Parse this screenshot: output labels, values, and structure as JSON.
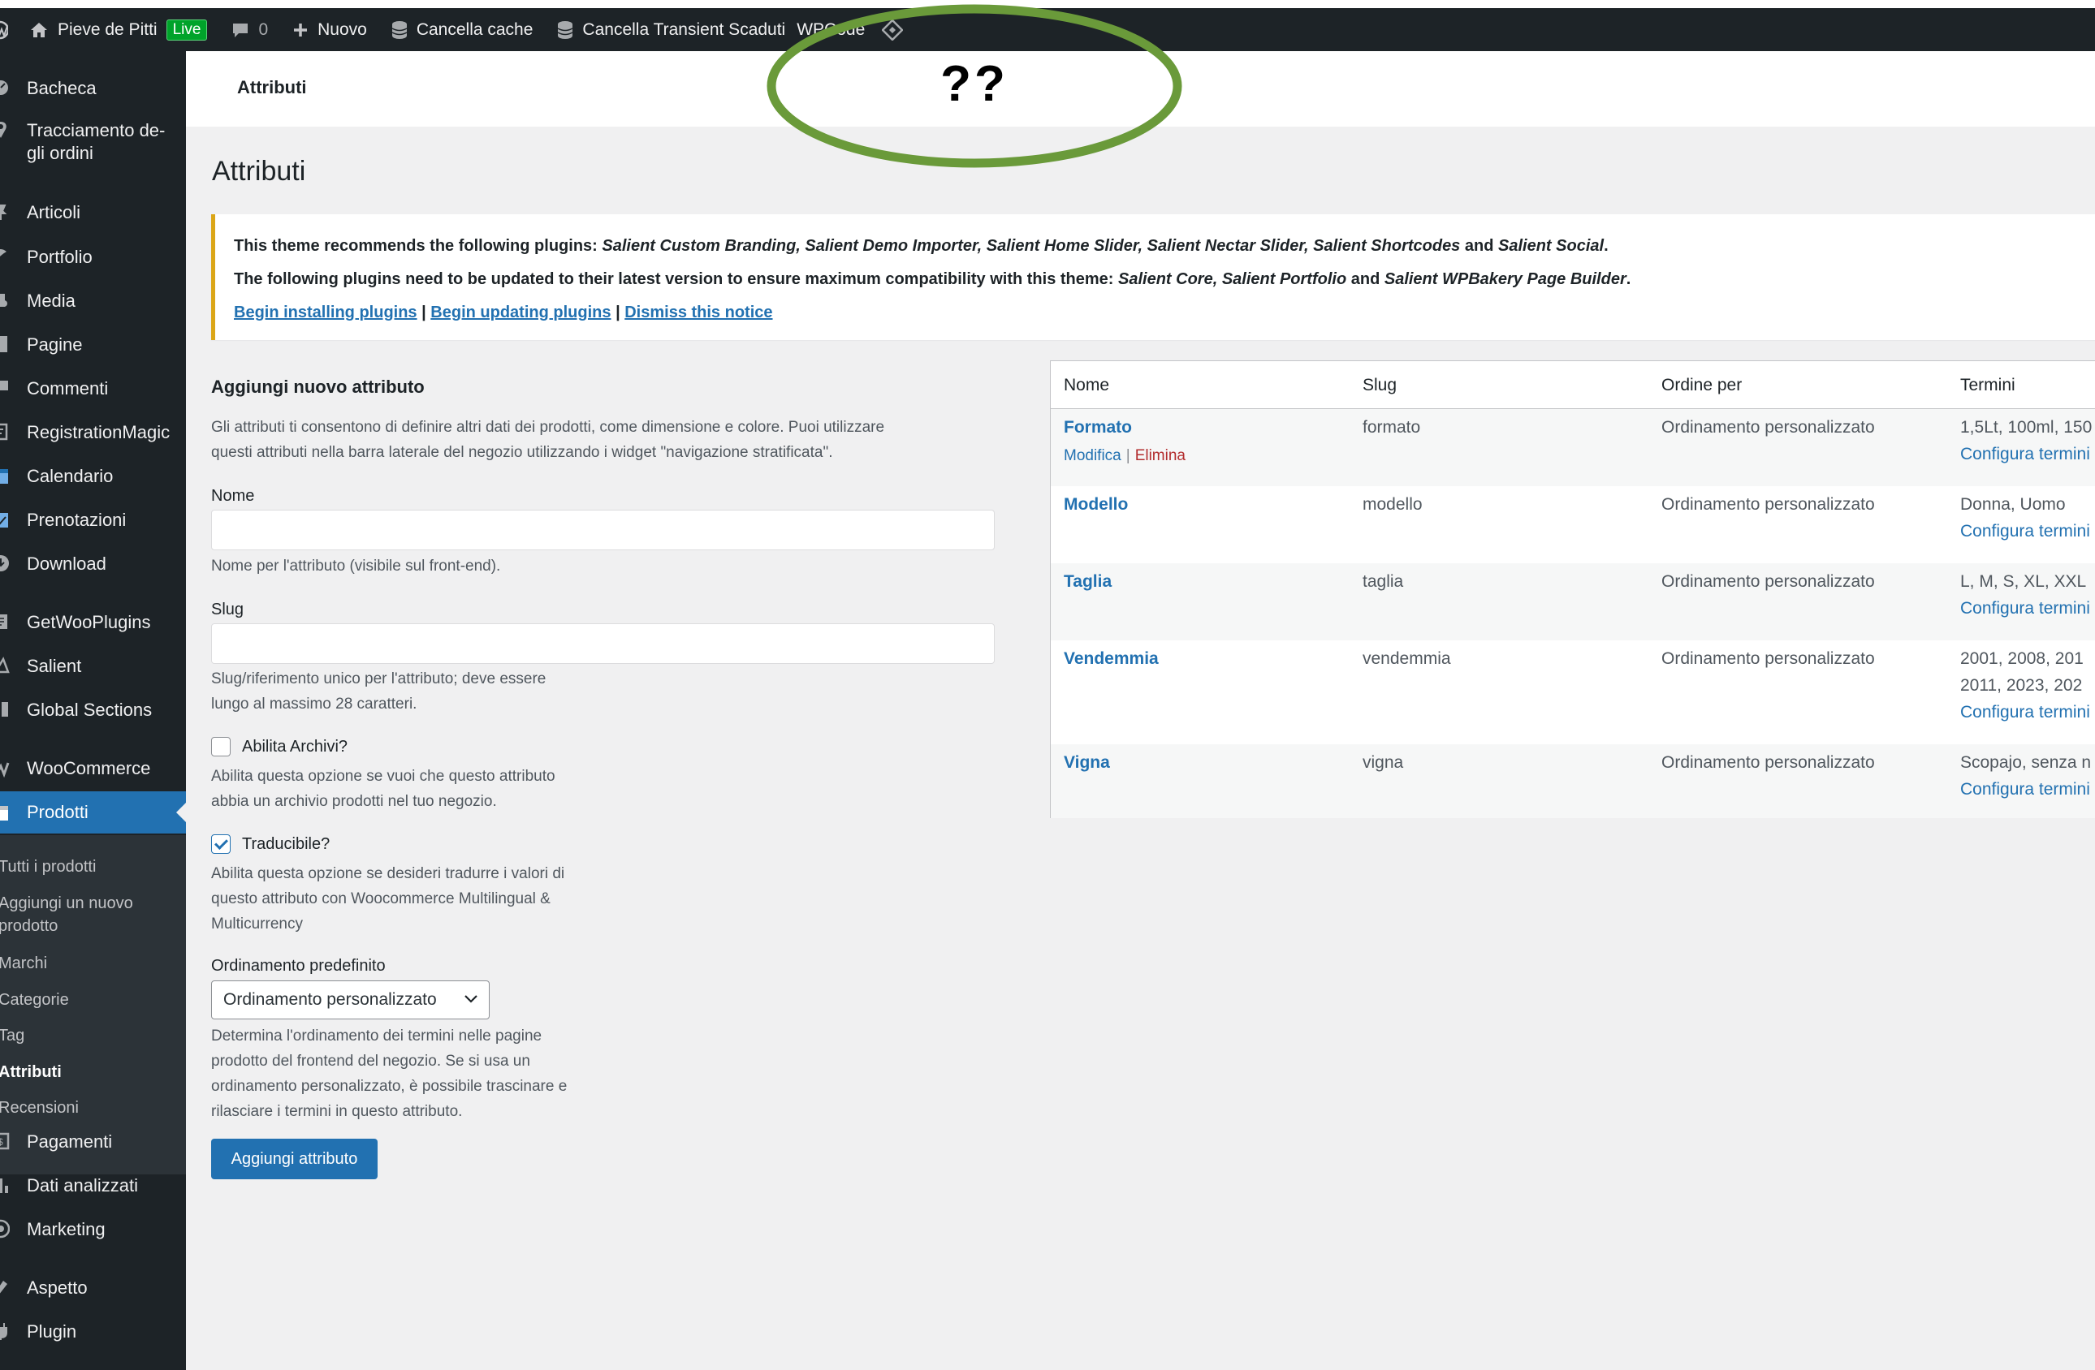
{
  "admin_bar": {
    "site_name": "Pieve de Pitti",
    "live_badge": "Live",
    "comments_count": "0",
    "new_label": "Nuovo",
    "clear_cache": "Cancella cache",
    "clear_transients": "Cancella Transient Scaduti",
    "wpcode": "WPCode"
  },
  "annotation": {
    "text": "??",
    "color": "#6a9a3a"
  },
  "header": {
    "title": "Attributi"
  },
  "sidebar": {
    "items": [
      {
        "label": "Bacheca",
        "icon": "dashboard-icon"
      },
      {
        "label": "Tracciamento de-",
        "label2": "gli ordini",
        "icon": "location-icon"
      },
      {
        "label": "Articoli",
        "icon": "pin-icon"
      },
      {
        "label": "Portfolio",
        "icon": "portfolio-icon"
      },
      {
        "label": "Media",
        "icon": "media-icon"
      },
      {
        "label": "Pagine",
        "icon": "page-icon"
      },
      {
        "label": "Commenti",
        "icon": "comment-icon"
      },
      {
        "label": "RegistrationMagic",
        "icon": "form-icon"
      },
      {
        "label": "Calendario",
        "icon": "calendar-icon"
      },
      {
        "label": "Prenotazioni",
        "icon": "booking-icon"
      },
      {
        "label": "Download",
        "icon": "download-icon"
      },
      {
        "label": "GetWooPlugins",
        "icon": "plugin-icon"
      },
      {
        "label": "Salient",
        "icon": "salient-icon"
      },
      {
        "label": "Global Sections",
        "icon": "sections-icon"
      },
      {
        "label": "WooCommerce",
        "icon": "woocommerce-icon"
      },
      {
        "label": "Prodotti",
        "icon": "products-icon"
      },
      {
        "label": "Pagamenti",
        "icon": "payments-icon"
      },
      {
        "label": "Dati analizzati",
        "icon": "analytics-icon"
      },
      {
        "label": "Marketing",
        "icon": "marketing-icon"
      },
      {
        "label": "Aspetto",
        "icon": "appearance-icon"
      },
      {
        "label": "Plugin",
        "icon": "plugins-icon"
      }
    ],
    "submenu": [
      {
        "label": "Tutti i prodotti"
      },
      {
        "label": "Aggiungi un nuovo",
        "label2": "prodotto"
      },
      {
        "label": "Marchi"
      },
      {
        "label": "Categorie"
      },
      {
        "label": "Tag"
      },
      {
        "label": "Attributi"
      },
      {
        "label": "Recensioni"
      }
    ]
  },
  "page": {
    "title": "Attributi"
  },
  "notice": {
    "line1_prefix": "This theme recommends the following plugins:",
    "line1_plugins": "Salient Custom Branding, Salient Demo Importer, Salient Home Slider, Salient Nectar Slider, Salient Shortcodes",
    "line1_and": "and",
    "line1_last": "Salient Social",
    "line2_prefix": "The following plugins need to be updated to their latest version to ensure maximum compatibility with this theme:",
    "line2_plugins": "Salient Core, Salient Portfolio",
    "line2_and": "and",
    "line2_last": "Salient WPBakery Page Builder",
    "link_install": "Begin installing plugins",
    "link_update": "Begin updating plugins",
    "link_dismiss": "Dismiss this notice",
    "separator": "|",
    "accent": "#dba617"
  },
  "form": {
    "heading": "Aggiungi nuovo attributo",
    "intro_line1": "Gli attributi ti consentono di definire altri dati dei prodotti, come dimensione e colore. Puoi utilizzare",
    "intro_line2": "questi attributi nella barra laterale del negozio utilizzando i widget \"navigazione stratificata\".",
    "name_label": "Nome",
    "name_value": "",
    "name_help": "Nome per l'attributo (visibile sul front-end).",
    "slug_label": "Slug",
    "slug_value": "",
    "slug_help_1": "Slug/riferimento unico per l'attributo; deve essere",
    "slug_help_2": "lungo al massimo 28 caratteri.",
    "archive_label": "Abilita Archivi?",
    "archive_checked": false,
    "archive_help_1": "Abilita questa opzione se vuoi che questo attributo",
    "archive_help_2": "abbia un archivio prodotti nel tuo negozio.",
    "translatable_label": "Traducibile?",
    "translatable_checked": true,
    "translatable_help_1": "Abilita questa opzione se desideri tradurre i valori di",
    "translatable_help_2": "questo attributo con Woocommerce Multilingual &",
    "translatable_help_3": "Multicurrency",
    "order_label": "Ordinamento predefinito",
    "order_value": "Ordinamento personalizzato",
    "order_help_1": "Determina l'ordinamento dei termini nelle pagine",
    "order_help_2": "prodotto del frontend del negozio. Se si usa un",
    "order_help_3": "ordinamento personalizzato, è possibile trascinare e",
    "order_help_4": "rilasciare i termini in questo attributo.",
    "submit": "Aggiungi attributo"
  },
  "table": {
    "headers": [
      "Nome",
      "Slug",
      "Ordine per",
      "Termini"
    ],
    "row_edit": "Modifica",
    "row_delete": "Elimina",
    "row_sep": "|",
    "configure": "Configura termini",
    "rows": [
      {
        "name": "Formato",
        "slug": "formato",
        "order": "Ordinamento personalizzato",
        "terms": "1,5Lt, 100ml, 150"
      },
      {
        "name": "Modello",
        "slug": "modello",
        "order": "Ordinamento personalizzato",
        "terms": "Donna, Uomo"
      },
      {
        "name": "Taglia",
        "slug": "taglia",
        "order": "Ordinamento personalizzato",
        "terms": "L, M, S, XL, XXL"
      },
      {
        "name": "Vendemmia",
        "slug": "vendemmia",
        "order": "Ordinamento personalizzato",
        "terms": "2001, 2008, 201",
        "terms2": "2011, 2023, 202"
      },
      {
        "name": "Vigna",
        "slug": "vigna",
        "order": "Ordinamento personalizzato",
        "terms": "Scopajo, senza n"
      }
    ]
  }
}
